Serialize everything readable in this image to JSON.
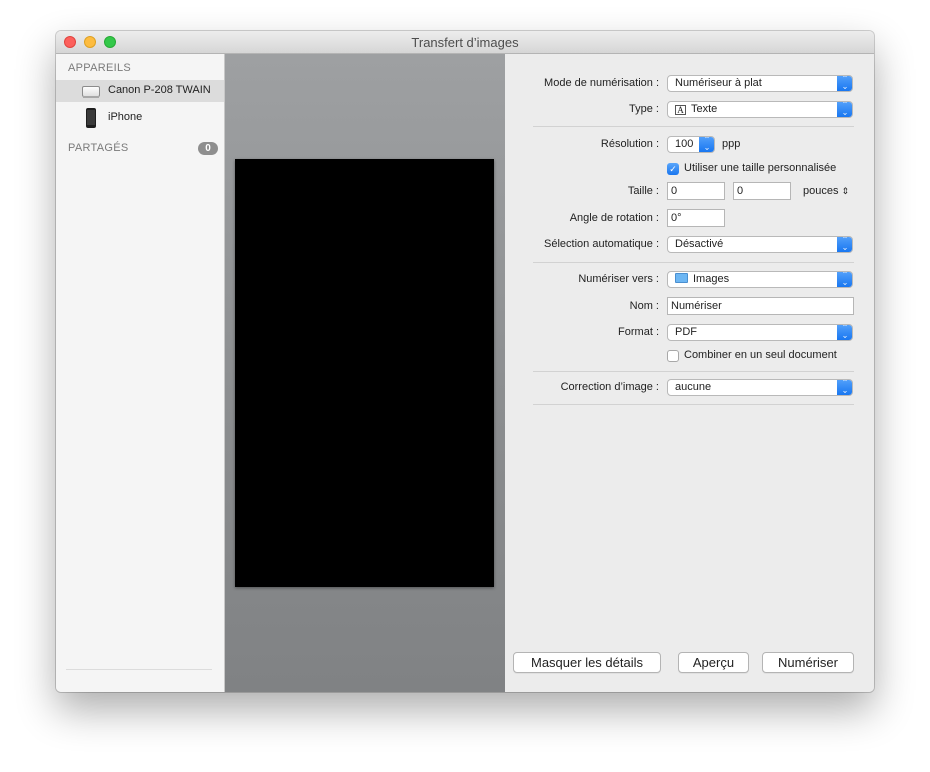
{
  "window": {
    "title": "Transfert d’images"
  },
  "sidebar": {
    "devices_header": "APPAREILS",
    "devices": [
      {
        "label": "Canon P-208 TWAIN",
        "icon": "scanner-icon",
        "selected": true
      },
      {
        "label": "iPhone",
        "icon": "iphone-icon",
        "selected": false
      }
    ],
    "shared_header": "PARTAGÉS",
    "shared_count": "0"
  },
  "settings": {
    "scan_mode": {
      "label": "Mode de numérisation :",
      "value": "Numériseur à plat"
    },
    "type": {
      "label": "Type :",
      "value": "Texte",
      "icon": "text-document-icon"
    },
    "resolution": {
      "label": "Résolution :",
      "value": "100",
      "unit": "ppp"
    },
    "custom_size": {
      "label": "Utiliser une taille personnalisée",
      "checked": true
    },
    "size": {
      "label": "Taille :",
      "width": "0",
      "height": "0",
      "unit": "pouces"
    },
    "rotation": {
      "label": "Angle de rotation :",
      "value": "0°"
    },
    "auto_selection": {
      "label": "Sélection automatique :",
      "value": "Désactivé"
    },
    "scan_to": {
      "label": "Numériser vers :",
      "value": "Images",
      "icon": "folder-icon"
    },
    "name": {
      "label": "Nom :",
      "value": "Numériser"
    },
    "format": {
      "label": "Format :",
      "value": "PDF"
    },
    "combine": {
      "label": "Combiner en un seul document",
      "checked": false
    },
    "correction": {
      "label": "Correction d’image :",
      "value": "aucune"
    }
  },
  "buttons": {
    "hide_details": "Masquer les détails",
    "overview": "Aperçu",
    "scan": "Numériser"
  },
  "colors": {
    "accent": "#1a76ef",
    "preview_bg": "#8a8c8e"
  }
}
